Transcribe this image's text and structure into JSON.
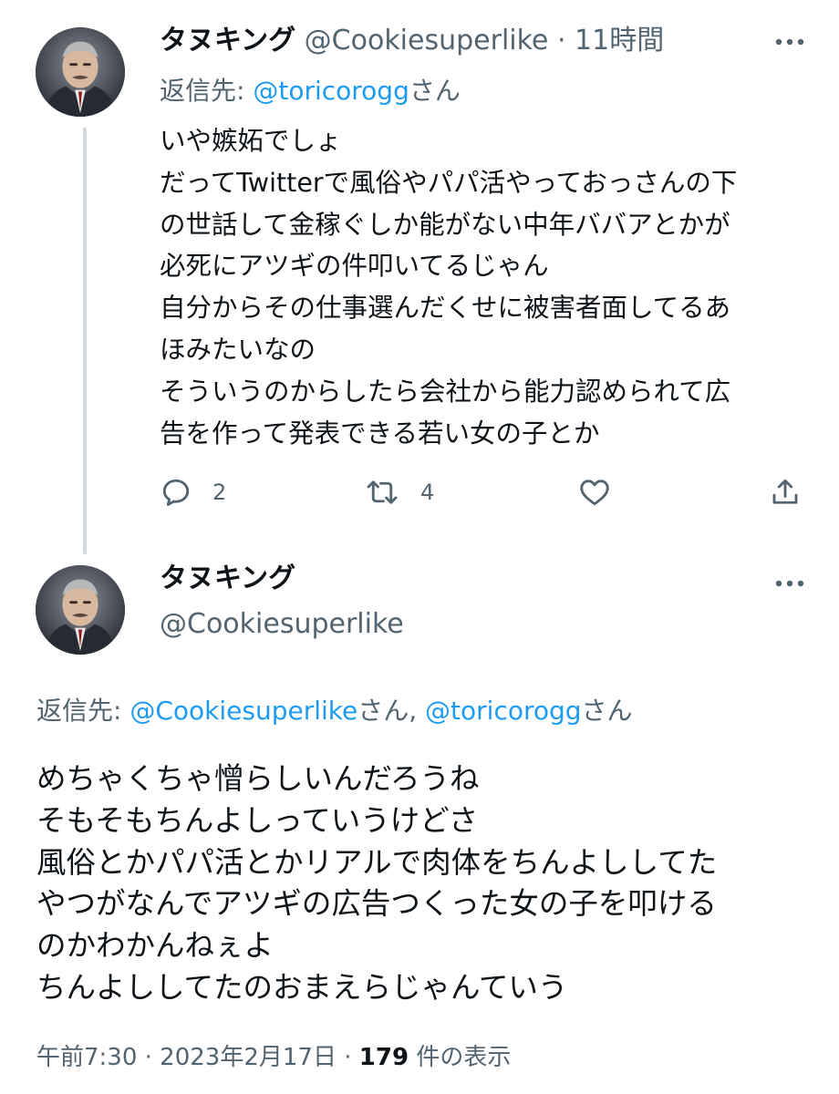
{
  "tweet1": {
    "display_name": "タヌキング",
    "handle": "@Cookiesuperlike",
    "separator": "·",
    "time_ago": "11時間",
    "reply_prefix": "返信先: ",
    "reply_to": "@toricorogg",
    "reply_suffix": "さん",
    "body_lines": [
      "いや嫉妬でしょ",
      "だってTwitterで風俗やパパ活やっておっさんの下",
      "の世話して金稼ぐしか能がない中年ババアとかが",
      "必死にアツギの件叩いてるじゃん",
      "自分からその仕事選んだくせに被害者面してるあ",
      "ほみたいなの",
      "そういうのからしたら会社から能力認められて広",
      "告を作って発表できる若い女の子とか"
    ],
    "actions": {
      "reply_icon": "reply-icon",
      "reply_count": "2",
      "retweet_icon": "retweet-icon",
      "retweet_count": "4",
      "like_icon": "heart-icon",
      "share_icon": "share-icon"
    }
  },
  "tweet2": {
    "display_name": "タヌキング",
    "handle": "@Cookiesuperlike",
    "reply_prefix": "返信先: ",
    "reply_to_1": "@Cookiesuperlike",
    "reply_mid": "さん, ",
    "reply_to_2": "@toricorogg",
    "reply_suffix": "さん",
    "body_lines": [
      "めちゃくちゃ憎らしいんだろうね",
      "そもそもちんよしっていうけどさ",
      "風俗とかパパ活とかリアルで肉体をちんよししてた",
      "やつがなんでアツギの広告つくった女の子を叩ける",
      "のかわかんねぇよ",
      "ちんよししてたのおまえらじゃんていう"
    ],
    "timestamp": "午前7:30 · 2023年2月17日 · ",
    "view_count": "179",
    "view_suffix": " 件の表示"
  },
  "colors": {
    "text": "#0f1419",
    "muted": "#536471",
    "link": "#1d9bf0",
    "thread_line": "#cfd9de"
  }
}
